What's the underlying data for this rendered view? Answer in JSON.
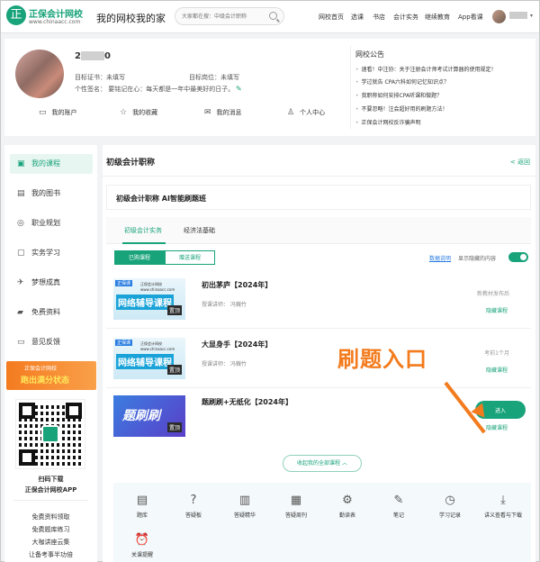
{
  "header": {
    "logo_glyph": "正",
    "logo_name": "正保会计网校",
    "logo_url_text": "www.chinaacc.com",
    "site_title": "我的网校我的家",
    "search_placeholder": "大家都在搜：中级会计职称",
    "nav": [
      "网校首页",
      "选课",
      "书店",
      "会计实务",
      "继续教育",
      "App看课"
    ]
  },
  "profile": {
    "name_visible": "2",
    "name_suffix": "0",
    "cert_label": "目标证书：未填写",
    "post_label": "目标岗位：未填写",
    "signature": "个性签名：  要铭记在心：每天都是一年中最美好的日子。",
    "links": [
      {
        "icon": "▭",
        "label": "我的账户"
      },
      {
        "icon": "☆",
        "label": "我的收藏"
      },
      {
        "icon": "✉",
        "label": "我的消息"
      },
      {
        "icon": "♙",
        "label": "个人中心"
      }
    ],
    "announce_title": "网校公告",
    "announcements": [
      "速看！中注协：关于注册会计师考试计算器的使用规定！",
      "学过就告 CPA六科如何记忆知识点？",
      "我职称如何安排CPA听课和做题？",
      "不要忽略！注会超好用的刷题方法！",
      "正保会计网校反诈骗声明"
    ]
  },
  "sidebar": {
    "items": [
      {
        "icon": "▣",
        "label": "我的课程"
      },
      {
        "icon": "▤",
        "label": "我的图书"
      },
      {
        "icon": "◎",
        "label": "职业规划"
      },
      {
        "icon": "▢",
        "label": "实务学习"
      },
      {
        "icon": "✈",
        "label": "梦想成真"
      },
      {
        "icon": "▰",
        "label": "免费资料"
      },
      {
        "icon": "▭",
        "label": "意见反馈"
      }
    ],
    "banner_line1": "正保会计网校",
    "banner_line2": "跑出满分状态",
    "scan_line1": "扫码下载",
    "scan_line2": "正保会计网校APP",
    "links": [
      "免费资料领取",
      "免费题库练习",
      "大咖讲座云集",
      "让备考事半功倍"
    ]
  },
  "main": {
    "heading": "初级会计职称",
    "back": "< 返回",
    "ai_card": "初级会计职称  AI智能刷题班",
    "tabs": [
      "初级会计实务",
      "经济法基础"
    ],
    "pill_on": "已购课程",
    "pill_off": "赠送课程",
    "data_link": "数据说明",
    "hide_label": "显示隐藏的内容",
    "courses": [
      {
        "title": "初出茅庐【2024年】",
        "teacher": "授课讲师：  冯巍竹",
        "status": "新教材发布后",
        "hide": "隐藏课程",
        "thumb_tag": "正保课",
        "thumb_sm": "正保会计网校 www.chinaacc.com",
        "thumb_big": "网络辅导课程",
        "thumb_badge": "置顶"
      },
      {
        "title": "大显身手【2024年】",
        "teacher": "授课讲师：  冯巍竹",
        "status": "考前1个月",
        "hide": "隐藏课程",
        "thumb_tag": "正保课",
        "thumb_sm": "正保会计网校 www.chinaacc.com",
        "thumb_big": "网络辅导课程",
        "thumb_badge": "置顶"
      },
      {
        "title": "题刷刷+无纸化【2024年】",
        "teacher": "",
        "status": "",
        "hide": "隐藏课程",
        "thumb_big": "题刷刷",
        "thumb_badge": "置顶",
        "enter": "进入"
      }
    ],
    "collapse": "收起我的全部课程  ︿",
    "tools": [
      {
        "icon": "▤",
        "label": "题库"
      },
      {
        "icon": "?",
        "label": "答疑板"
      },
      {
        "icon": "▥",
        "label": "答疑精华"
      },
      {
        "icon": "▦",
        "label": "答疑周刊"
      },
      {
        "icon": "⚙",
        "label": "勤读表"
      },
      {
        "icon": "✎",
        "label": "笔记"
      },
      {
        "icon": "◷",
        "label": "学习记录"
      },
      {
        "icon": "⤓",
        "label": "讲义查看与下载"
      },
      {
        "icon": "⏰",
        "label": "关课提醒"
      }
    ],
    "overlay": "刷题入口"
  },
  "colors": {
    "accent": "#19a37a",
    "overlay": "#f37b1d"
  }
}
